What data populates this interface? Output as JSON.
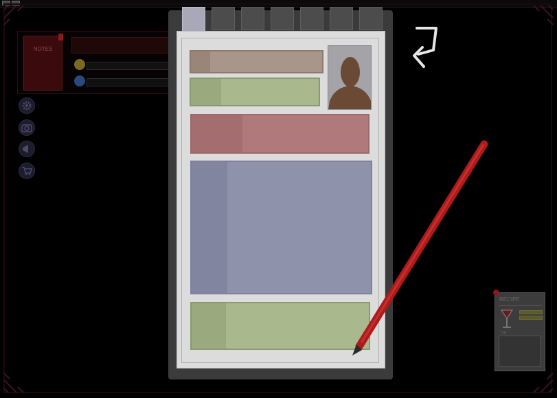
{
  "window": {
    "title": ""
  },
  "colors": {
    "background": "#000000",
    "frame_accent": "#2a0c14",
    "board": "#3b3b3b",
    "paper": "#dcdcdc",
    "field_tan": "#a8968a",
    "field_green": "#aab88e",
    "field_red": "#b07a7c",
    "field_blue": "#8f92ab",
    "pencil": "#b01a1a"
  },
  "left_panel": {
    "book_label": "NOTES",
    "coin_icons": [
      "gold-coin-icon",
      "blue-coin-icon"
    ]
  },
  "side_menu": {
    "items": [
      {
        "icon": "gear-icon"
      },
      {
        "icon": "camera-icon"
      },
      {
        "icon": "megaphone-icon"
      },
      {
        "icon": "cart-icon"
      }
    ]
  },
  "notebook": {
    "tabs": [
      {
        "active": true
      },
      {
        "active": false
      },
      {
        "active": false
      },
      {
        "active": false
      },
      {
        "active": false
      },
      {
        "active": false
      },
      {
        "active": false
      }
    ],
    "fields": [
      {
        "name": "name-field"
      },
      {
        "name": "subtitle-field"
      },
      {
        "name": "trait-field"
      },
      {
        "name": "description-field"
      },
      {
        "name": "notes-field"
      }
    ],
    "photo": "silhouette-portrait"
  },
  "back_button": {
    "icon": "return-arrow-icon"
  },
  "recipe_card": {
    "title": "RECIPE",
    "section_label": "TIP",
    "icon": "cocktail-glass-icon"
  }
}
